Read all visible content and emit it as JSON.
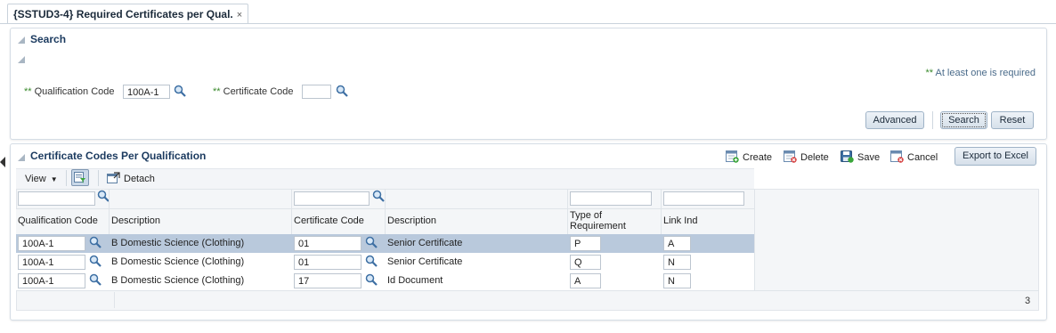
{
  "tab": {
    "title": "{SSTUD3-4} Required Certificates per Qual.",
    "close": "×"
  },
  "search": {
    "title": "Search",
    "required_note_marker": "**",
    "required_note": "At least one is required",
    "qualification_label": "Qualification Code",
    "qualification_value": "100A-1",
    "certificate_label": "Certificate Code",
    "certificate_value": "",
    "advanced_button": "Advanced",
    "search_button": "Search",
    "reset_button": "Reset"
  },
  "results": {
    "title": "Certificate Codes Per Qualification",
    "create": "Create",
    "delete": "Delete",
    "save": "Save",
    "cancel": "Cancel",
    "export": "Export to Excel",
    "view": "View",
    "detach": "Detach",
    "columns": [
      "Qualification Code",
      "Description",
      "Certificate Code",
      "Description",
      "Type of",
      "Requirement",
      "Link Ind"
    ],
    "rows": [
      {
        "qual": "100A-1",
        "qual_desc": "B Domestic Science (Clothing)",
        "cert": "01",
        "cert_desc": "Senior Certificate",
        "type": "P",
        "link": "A"
      },
      {
        "qual": "100A-1",
        "qual_desc": "B Domestic Science (Clothing)",
        "cert": "01",
        "cert_desc": "Senior Certificate",
        "type": "Q",
        "link": "N"
      },
      {
        "qual": "100A-1",
        "qual_desc": "B Domestic Science (Clothing)",
        "cert": "17",
        "cert_desc": "Id Document",
        "type": "A",
        "link": "N"
      }
    ],
    "row_count": "3"
  },
  "colors": {
    "selected_row": "#b9c9dc",
    "required_marker": "#3a8a2c",
    "title": "#1b3a5f"
  }
}
